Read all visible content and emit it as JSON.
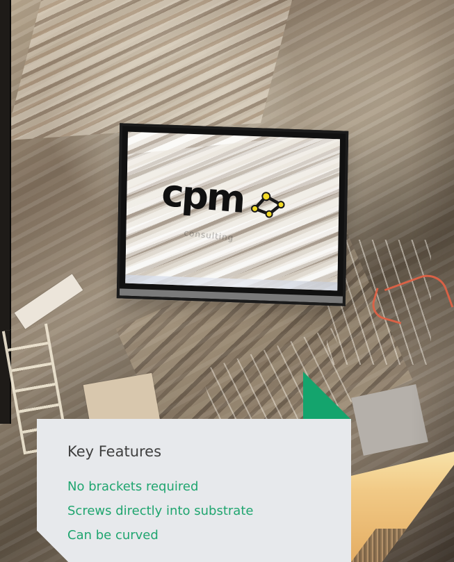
{
  "feature_card": {
    "title": "Key Features",
    "items": [
      "No brackets required",
      "Screws directly into substrate",
      "Can be curved"
    ]
  },
  "screen_brand": {
    "name": "cpm",
    "subtitle": "consulting"
  },
  "colors": {
    "accent_green": "#1fa56f",
    "card_background": "#e7e9ec",
    "title_text": "#3e3e3e",
    "triangle_green": "#14a46d"
  }
}
